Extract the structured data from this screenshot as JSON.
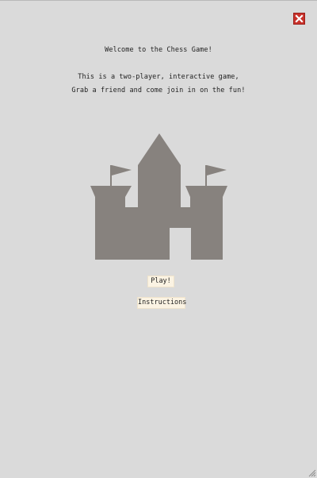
{
  "header": {
    "close_icon": "close-icon",
    "close_color": "#c8322b"
  },
  "intro": {
    "welcome": "Welcome to the Chess Game!",
    "line1": "This is a two-player, interactive game,",
    "line2": "Grab a friend and come join in on the fun!"
  },
  "illustration": {
    "icon": "castle-icon",
    "color": "#87827e"
  },
  "buttons": {
    "play_label": "Play!",
    "instructions_label": "Instructions",
    "background": "#fbf3e3"
  },
  "window": {
    "background": "#dadada",
    "resize_icon": "resize-grip-icon"
  }
}
